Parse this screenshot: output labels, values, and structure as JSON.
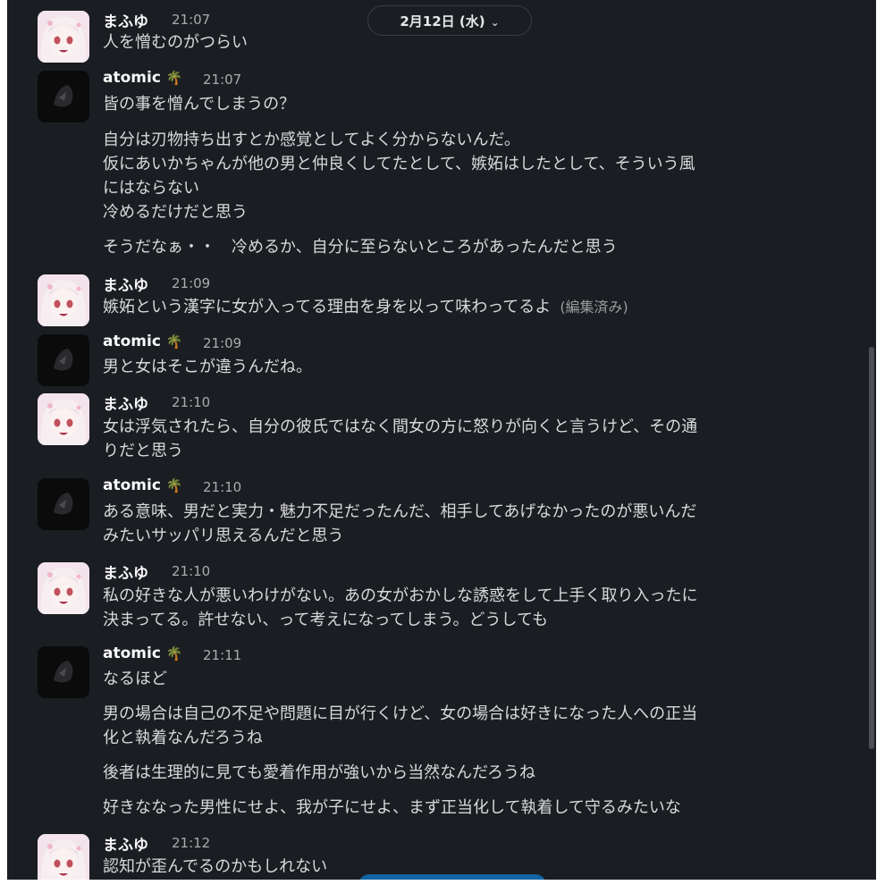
{
  "date_divider": {
    "label": "2月12日 (水)",
    "chevron": "chevron-down-icon"
  },
  "colors": {
    "background": "#1a1d21",
    "name": "#f8f8f8",
    "text": "#d9d9da",
    "timestamp": "#ababad",
    "accent": "#1264a3"
  },
  "messages": [
    {
      "author": "まふゆ",
      "time": "21:07",
      "avatar": "mafuyu-avatar",
      "lines": [
        "人を憎むのがつらい"
      ]
    },
    {
      "author": "atomic",
      "badge": "🌴",
      "time": "21:07",
      "avatar": "atomic-avatar",
      "lines": [
        "皆の事を憎んでしまうの？",
        "自分は刃物持ち出すとか感覚としてよく分からないんだ。",
        "仮にあいかちゃんが他の男と仲良くしてたとして、嫉妬はしたとして、そういう風",
        "にはならない",
        "冷めるだけだと思う",
        "そうだなぁ・・　冷めるか、自分に至らないところがあったんだと思う"
      ]
    },
    {
      "author": "まふゆ",
      "time": "21:09",
      "avatar": "mafuyu-avatar",
      "lines": [
        "嫉妬という漢字に女が入ってる理由を身を以って味わってるよ"
      ],
      "edited": "(編集済み)"
    },
    {
      "author": "atomic",
      "badge": "🌴",
      "time": "21:09",
      "avatar": "atomic-avatar",
      "lines": [
        "男と女はそこが違うんだね。"
      ]
    },
    {
      "author": "まふゆ",
      "time": "21:10",
      "avatar": "mafuyu-avatar",
      "lines": [
        "女は浮気されたら、自分の彼氏ではなく間女の方に怒りが向くと言うけど、その通",
        "りだと思う"
      ]
    },
    {
      "author": "atomic",
      "badge": "🌴",
      "time": "21:10",
      "avatar": "atomic-avatar",
      "lines": [
        "ある意味、男だと実力・魅力不足だったんだ、相手してあげなかったのが悪いんだ",
        "みたいサッパリ思えるんだと思う"
      ]
    },
    {
      "author": "まふゆ",
      "time": "21:10",
      "avatar": "mafuyu-avatar",
      "lines": [
        "私の好きな人が悪いわけがない。あの女がおかしな誘惑をして上手く取り入ったに",
        "決まってる。許せない、って考えになってしまう。どうしても"
      ]
    },
    {
      "author": "atomic",
      "badge": "🌴",
      "time": "21:11",
      "avatar": "atomic-avatar",
      "lines": [
        "なるほど",
        "男の場合は自己の不足や問題に目が行くけど、女の場合は好きになった人への正当",
        "化と執着なんだろうね",
        "後者は生理的に見ても愛着作用が強いから当然なんだろうね",
        "好きななった男性にせよ、我が子にせよ、まず正当化して執着して守るみたいな"
      ]
    },
    {
      "author": "まふゆ",
      "time": "21:12",
      "avatar": "mafuyu-avatar",
      "lines": [
        "認知が歪んでるのかもしれない"
      ]
    }
  ]
}
